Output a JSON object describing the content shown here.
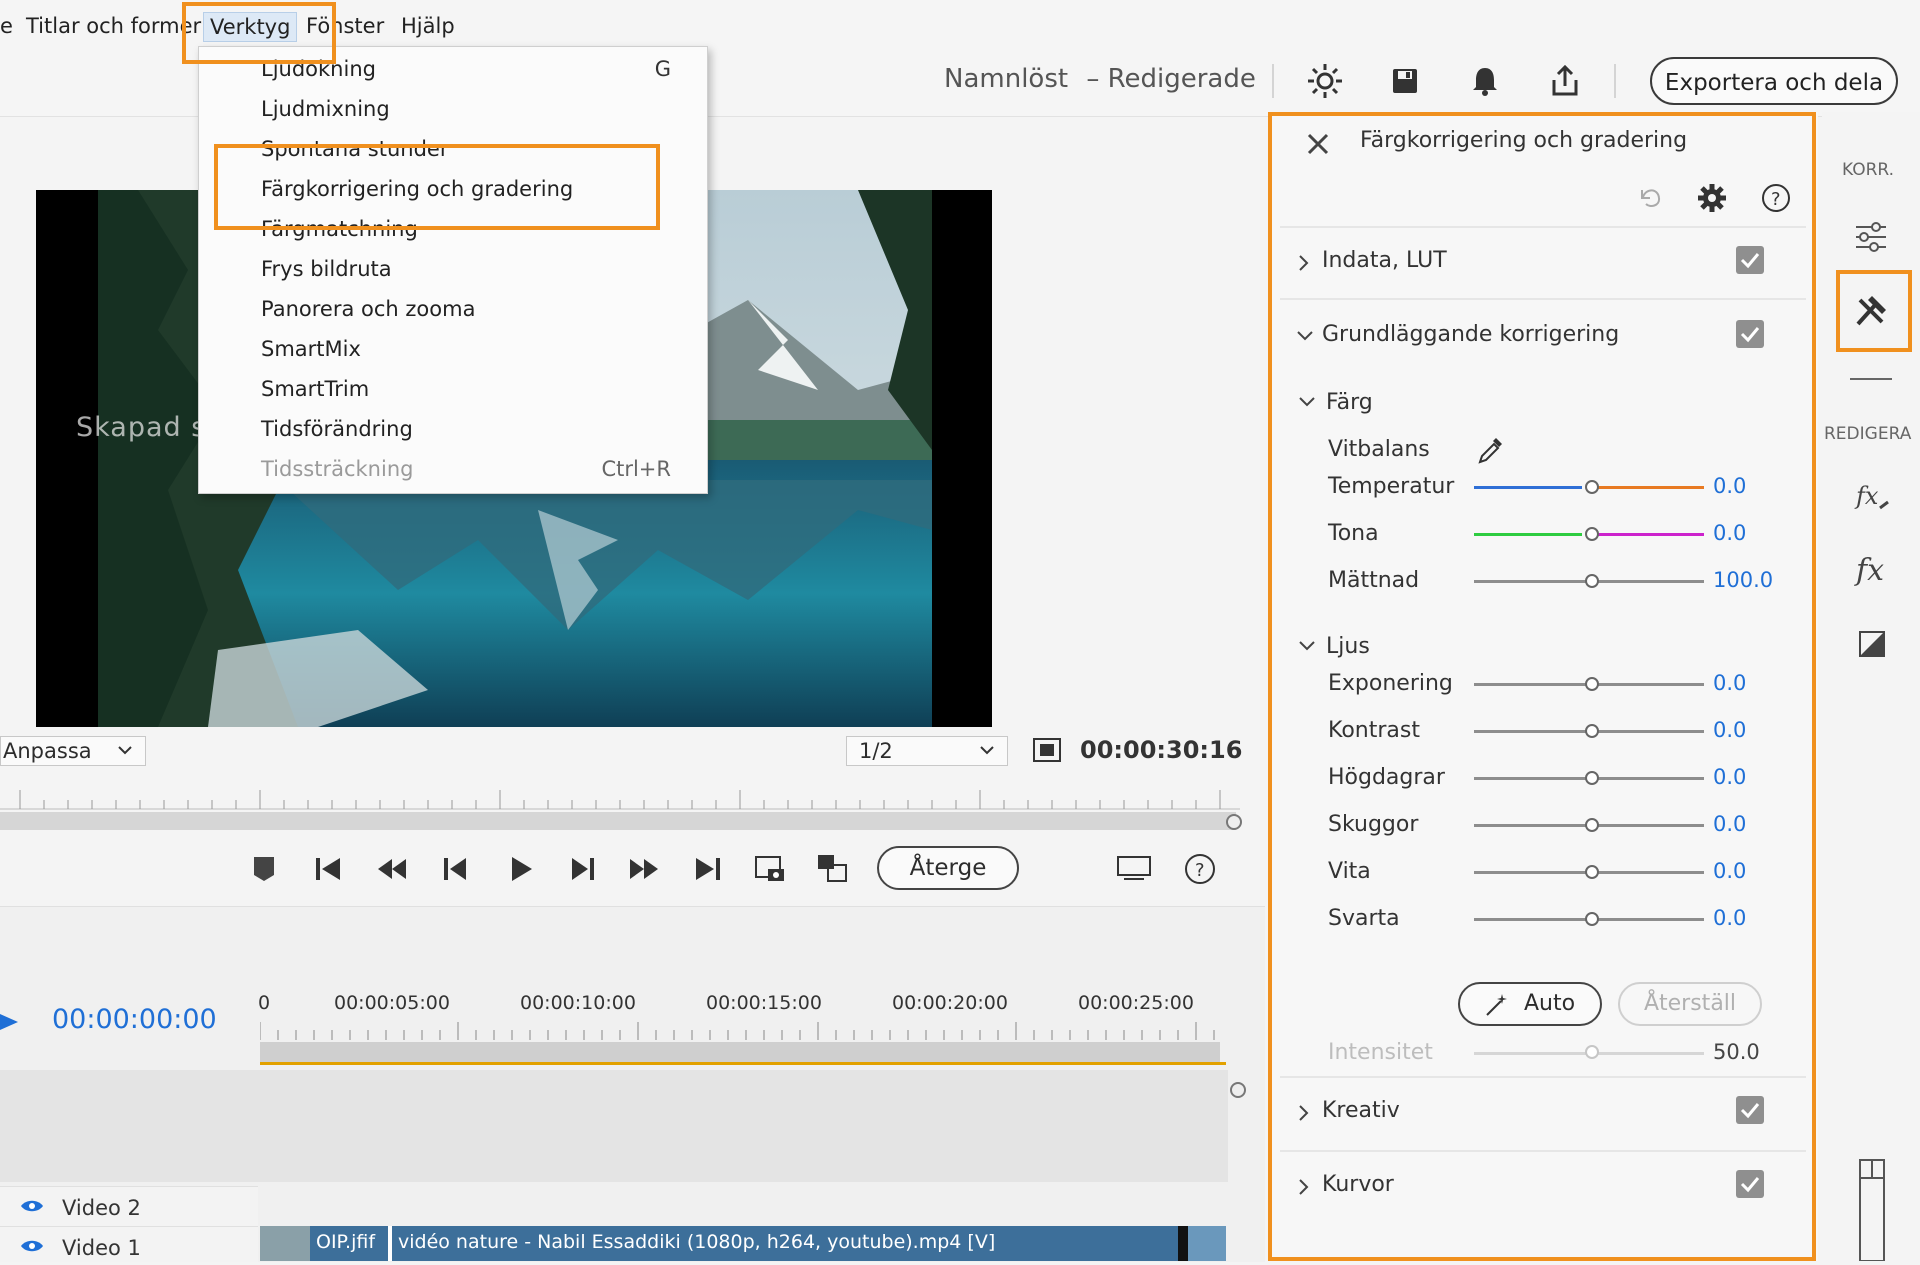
{
  "menubar": {
    "items": [
      "e",
      "Titlar och former",
      "Verktyg",
      "Fönster",
      "Hjälp"
    ]
  },
  "toolbar": {
    "project_name": "Namnlöst",
    "project_state": "– Redigerade",
    "export_label": "Exportera och dela"
  },
  "tools_menu": {
    "items": [
      {
        "label": "Ljudokning",
        "shortcut": "G"
      },
      {
        "label": "Ljudmixning",
        "shortcut": ""
      },
      {
        "label": "Spontana stunder",
        "shortcut": ""
      },
      {
        "label": "Färgkorrigering och gradering",
        "shortcut": ""
      },
      {
        "label": "Färgmatchning",
        "shortcut": ""
      },
      {
        "label": "Frys bildruta",
        "shortcut": ""
      },
      {
        "label": "Panorera och zooma",
        "shortcut": ""
      },
      {
        "label": "SmartMix",
        "shortcut": ""
      },
      {
        "label": "SmartTrim",
        "shortcut": ""
      },
      {
        "label": "Tidsförändring",
        "shortcut": ""
      },
      {
        "label": "Tidssträckning",
        "shortcut": "Ctrl+R"
      }
    ]
  },
  "monitor": {
    "watermark": "Skapad                                                           s testversion",
    "fit_label": "Anpassa",
    "quality_label": "1/2",
    "timecode": "00:00:30:16",
    "render_label": "Återge"
  },
  "timeline": {
    "current_time": "00:00:00:00",
    "ticks": [
      "0",
      "00:00:05:00",
      "00:00:10:00",
      "00:00:15:00",
      "00:00:20:00",
      "00:00:25:00"
    ],
    "tracks": [
      "Video 2",
      "Video 1"
    ],
    "clip_small": "OIP.jfif",
    "clip_main": "vidéo nature - Nabil Essaddiki (1080p, h264, youtube).mp4 [V]"
  },
  "panel": {
    "title": "Färgkorrigering och gradering",
    "sections": {
      "indata": "Indata, LUT",
      "grund": "Grundläggande korrigering",
      "kreativ": "Kreativ",
      "kurvor": "Kurvor"
    },
    "farg_label": "Färg",
    "vitbalans_label": "Vitbalans",
    "ljus_label": "Ljus",
    "sliders": [
      {
        "label": "Temperatur",
        "value": "0.0"
      },
      {
        "label": "Tona",
        "value": "0.0"
      },
      {
        "label": "Mättnad",
        "value": "100.0"
      },
      {
        "label": "Exponering",
        "value": "0.0"
      },
      {
        "label": "Kontrast",
        "value": "0.0"
      },
      {
        "label": "Högdagrar",
        "value": "0.0"
      },
      {
        "label": "Skuggor",
        "value": "0.0"
      },
      {
        "label": "Vita",
        "value": "0.0"
      },
      {
        "label": "Svarta",
        "value": "0.0"
      }
    ],
    "auto_label": "Auto",
    "reset_label": "Återställ",
    "intensity_label": "Intensitet",
    "intensity_value": "50.0"
  },
  "rail": {
    "korr_label": "KORR.",
    "redigera_label": "REDIGERA"
  },
  "colors": {
    "accent_blue": "#1f6fd6",
    "highlight_orange": "#f0901e",
    "timeline_orange": "#e2a100"
  }
}
